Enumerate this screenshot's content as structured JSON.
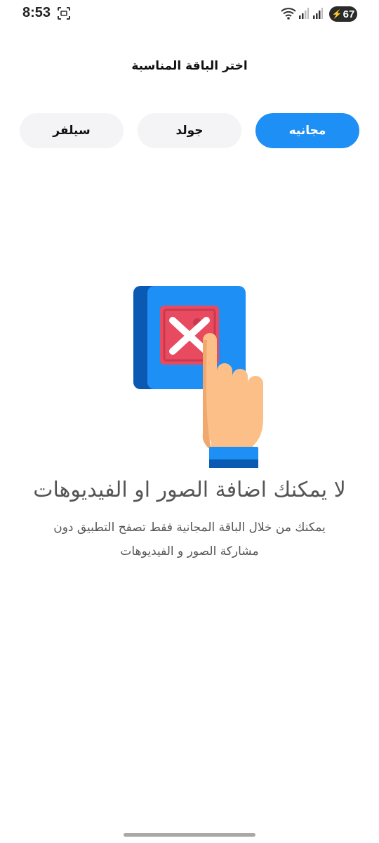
{
  "status_bar": {
    "time": "8:53",
    "battery": "67"
  },
  "header": {
    "title": "اختر الباقة المناسبة"
  },
  "tabs": [
    {
      "label": "مجانيه",
      "active": true
    },
    {
      "label": "جولد",
      "active": false
    },
    {
      "label": "سيلفر",
      "active": false
    }
  ],
  "message": {
    "headline": "لا يمكنك اضافة الصور او الفيديوهات",
    "description": "يمكنك من خلال الباقة المجانية فقط تصفح التطبيق دون مشاركة الصور و الفيديوهات"
  },
  "colors": {
    "accent": "#1e90f5",
    "tab_bg": "#f4f4f6",
    "illustration_blue": "#1e90f5",
    "illustration_dark_blue": "#0a5ab4",
    "illustration_red": "#e84a5f",
    "hand_skin": "#fbbf87"
  },
  "icons": {
    "illustration": "blocked-image-hand-icon"
  }
}
